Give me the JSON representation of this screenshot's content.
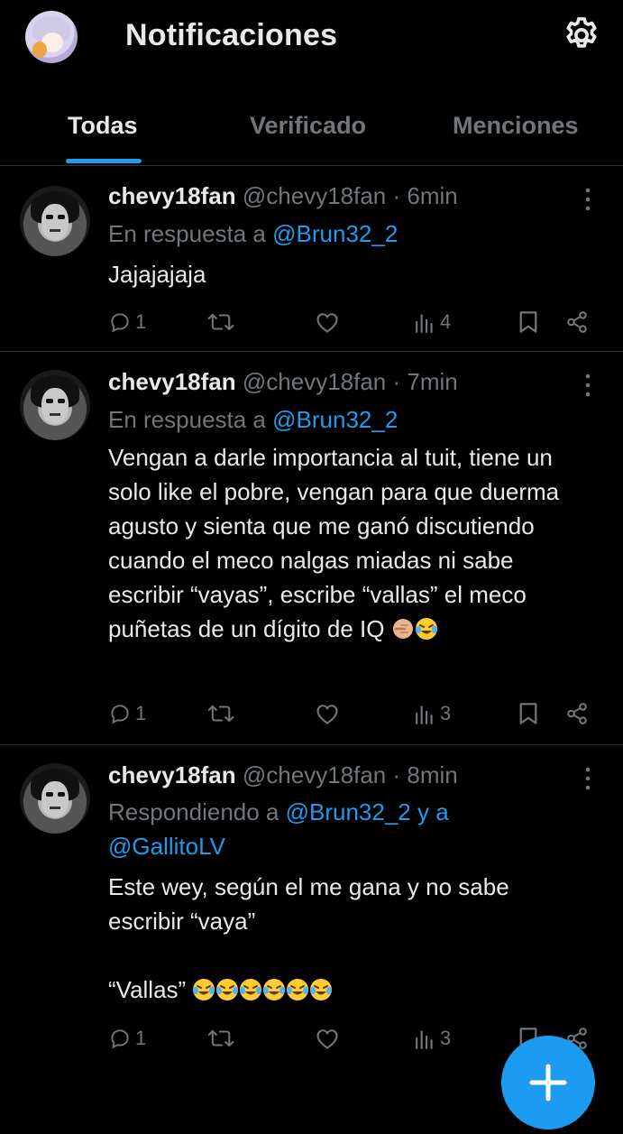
{
  "header": {
    "title": "Notificaciones"
  },
  "tabs": [
    {
      "label": "Todas",
      "active": true
    },
    {
      "label": "Verificado",
      "active": false
    },
    {
      "label": "Menciones",
      "active": false
    }
  ],
  "posts": [
    {
      "name": "chevy18fan",
      "handle_time": "@chevy18fan · 6min",
      "reply_prefix": "En respuesta a ",
      "reply_mentions": "@Brun32_2",
      "reply_extra": "",
      "body_lines": [
        "Jajajajaja"
      ],
      "body_emojis": "",
      "replies": "1",
      "views": "4"
    },
    {
      "name": "chevy18fan",
      "handle_time": "@chevy18fan · 7min",
      "reply_prefix": "En respuesta a ",
      "reply_mentions": "@Brun32_2",
      "reply_extra": "",
      "body_text": "Vengan a darle importancia al tuit, tiene un solo like el pobre, vengan para que duerma agusto y sienta que me ganó discutiendo cuando el meco nalgas miadas ni sabe escribir “vayas”, escribe “vallas” el meco puñetas de un dígito de IQ",
      "replies": "1",
      "views": "3"
    },
    {
      "name": "chevy18fan",
      "handle_time": "@chevy18fan · 8min",
      "reply_prefix": "Respondiendo a ",
      "reply_mentions": "@Brun32_2 y a",
      "reply_extra": "@GallitoLV",
      "body_text": "Este wey, según el me gana y no sabe escribir “vaya”",
      "body_text2": "“Vallas”",
      "replies": "1",
      "views": "3"
    }
  ],
  "colors": {
    "accent": "#1d9bf0",
    "muted": "#71767b",
    "border": "#2f3336"
  },
  "icons": [
    "settings-gear-icon",
    "reply-icon",
    "retweet-icon",
    "like-icon",
    "views-icon",
    "bookmark-icon",
    "share-icon",
    "more-icon",
    "plus-icon"
  ]
}
